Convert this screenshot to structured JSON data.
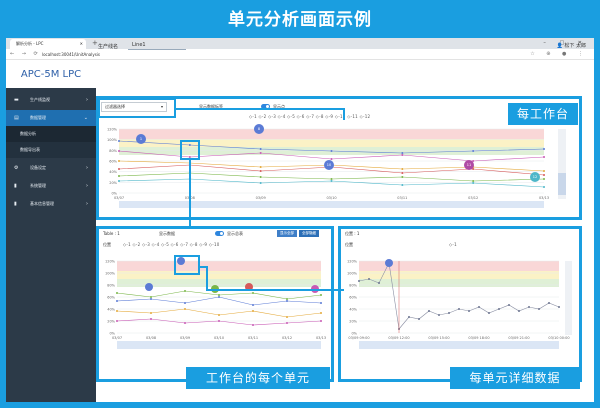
{
  "frame": {
    "title": "单元分析画面示例",
    "callouts": {
      "top": "每工作台",
      "bottom_left": "工作台的每个单元",
      "bottom_right": "每单元详细数据"
    }
  },
  "browser": {
    "tab_title": "解析分析 - LPC",
    "url": "localhost:30041/UnitAnalysis"
  },
  "app": {
    "brand": "APC-5M LPC",
    "user": "松下 太郎",
    "unit_label": "生产线名",
    "unit_value": "Line1",
    "sidebar": [
      {
        "label": "生产线监视",
        "icon": "folder-icon",
        "type": "parent"
      },
      {
        "label": "数据管理",
        "icon": "database-icon",
        "type": "parent-open"
      },
      {
        "label": "数据分析",
        "type": "sub-active"
      },
      {
        "label": "数据导出表",
        "type": "sub"
      },
      {
        "label": "设备设定",
        "icon": "gear-icon",
        "type": "parent"
      },
      {
        "label": "系统管理",
        "icon": "file-icon",
        "type": "parent"
      },
      {
        "label": "基本信息管理",
        "icon": "file-icon",
        "type": "parent"
      }
    ]
  },
  "top_panel": {
    "select_value": "过滤器选择",
    "toggle1_label": "显示数据标签",
    "toggle2_label": "显示点",
    "legend": "◇-1 ◇-2 ◇-3 ◇-4 ◇-5 ◇-6 ◇-7 ◇-8 ◇-9 ◇-10 ◇-11 ◇-12",
    "bubbles": [
      "1",
      "8",
      "10",
      "11",
      "12"
    ],
    "chart": {
      "x_ticks": [
        "03/07",
        "03/08",
        "03/09",
        "03/10",
        "03/11",
        "03/12",
        "03/13"
      ],
      "y_ticks": [
        "120%",
        "100%",
        "80%",
        "60%",
        "40%",
        "20%",
        "0%"
      ]
    }
  },
  "bl_panel": {
    "title": "Table : 1",
    "toggle_label1": "显示数据",
    "toggle_label2": "显示总表",
    "btn1": "显示全部",
    "btn2": "全部隐藏",
    "y_label": "位置",
    "legend": "◇-1 ◇-2 ◇-3 ◇-4 ◇-5 ◇-6 ◇-7 ◇-8 ◇-9 ◇-10",
    "x_ticks": [
      "03/07",
      "03/08",
      "03/09",
      "03/10",
      "03/11",
      "03/12",
      "03/13"
    ],
    "y_ticks": [
      "120%",
      "100%",
      "80%",
      "60%",
      "40%",
      "20%",
      "0%"
    ]
  },
  "br_panel": {
    "title": "位置 : 1",
    "y_label": "位置",
    "legend": "◇-1",
    "x_ticks": [
      "03/09 09:00",
      "03/09 12:00",
      "03/09 15:00",
      "03/09 18:00",
      "03/09 21:00",
      "03/10 00:00"
    ],
    "y_ticks": [
      "120%",
      "100%",
      "80%",
      "60%",
      "40%",
      "20%",
      "0%"
    ]
  }
}
